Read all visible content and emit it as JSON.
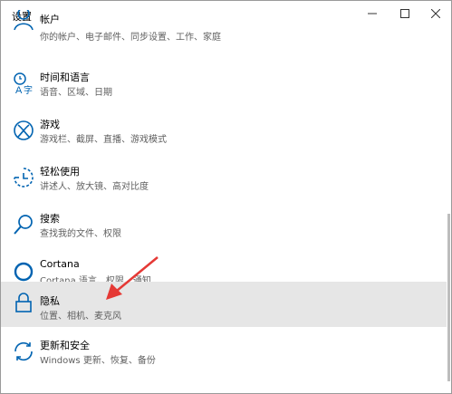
{
  "window": {
    "title": "设置"
  },
  "items": [
    {
      "name": "帐户",
      "desc": "你的帐户、电子邮件、同步设置、工作、家庭",
      "icon": "account-icon"
    },
    {
      "name": "时间和语言",
      "desc": "语音、区域、日期",
      "icon": "time-language-icon"
    },
    {
      "name": "游戏",
      "desc": "游戏栏、截屏、直播、游戏模式",
      "icon": "xbox-icon"
    },
    {
      "name": "轻松使用",
      "desc": "讲述人、放大镜、高对比度",
      "icon": "ease-of-access-icon"
    },
    {
      "name": "搜索",
      "desc": "查找我的文件、权限",
      "icon": "search-icon"
    },
    {
      "name": "Cortana",
      "desc": "Cortana 语言、权限、通知",
      "icon": "cortana-icon"
    },
    {
      "name": "隐私",
      "desc": "位置、相机、麦克风",
      "icon": "lock-icon"
    },
    {
      "name": "更新和安全",
      "desc": "Windows 更新、恢复、备份",
      "icon": "update-icon"
    }
  ],
  "selected_item": "隐私",
  "colors": {
    "icon": "#0063b1",
    "selected_bg": "#e6e6e6",
    "annotation_arrow": "#e53935"
  }
}
